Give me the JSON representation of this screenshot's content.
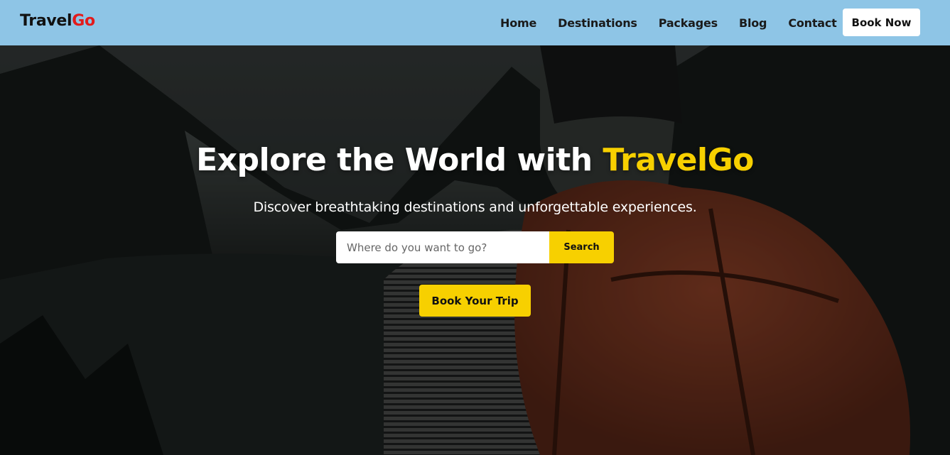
{
  "nav": {
    "logo_main": "Travel",
    "logo_accent": "Go",
    "links": [
      "Home",
      "Destinations",
      "Packages",
      "Blog",
      "Contact"
    ],
    "cta": "Book Now"
  },
  "hero": {
    "title_main": "Explore the World with ",
    "title_accent": "TravelGo",
    "subtitle": "Discover breathtaking destinations and unforgettable experiences.",
    "search_placeholder": "Where do you want to go?",
    "search_button": "Search",
    "trip_button": "Book Your Trip"
  },
  "colors": {
    "navbar": "#8ec5e6",
    "accent_yellow": "#f7d000",
    "logo_accent_red": "#e31b1b"
  }
}
